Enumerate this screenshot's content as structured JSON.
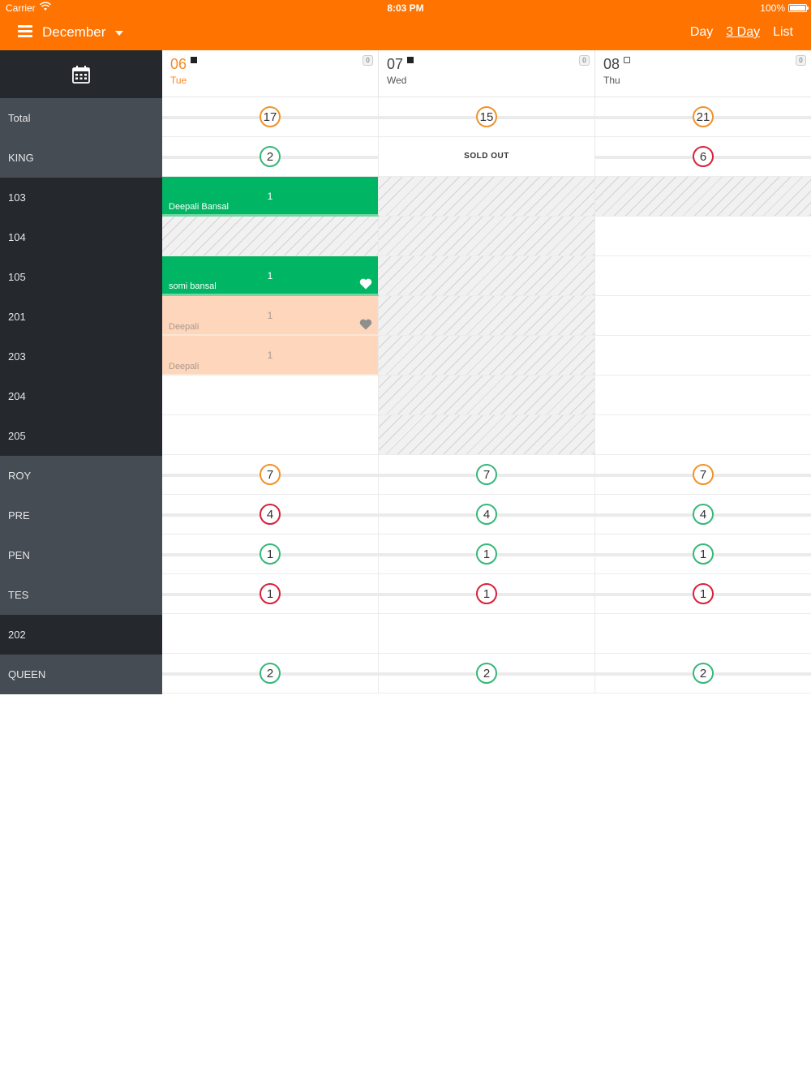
{
  "status_bar": {
    "carrier": "Carrier",
    "time": "8:03 PM",
    "battery": "100%"
  },
  "nav": {
    "month": "December",
    "tabs": [
      "Day",
      "3 Day",
      "List"
    ],
    "active_tab": "3 Day"
  },
  "colors": {
    "brand": "#ff7300",
    "today": "#f58a1f",
    "booked": "#00b564",
    "tentative": "#fed6bb",
    "sidebar_type": "#464c54",
    "sidebar_room": "#25292d"
  },
  "days": [
    {
      "num": "06",
      "name": "Tue",
      "count": "0",
      "today": true,
      "note": "filled"
    },
    {
      "num": "07",
      "name": "Wed",
      "count": "0",
      "today": false,
      "note": "filled"
    },
    {
      "num": "08",
      "name": "Thu",
      "count": "0",
      "today": false,
      "note": "empty"
    }
  ],
  "rows": [
    {
      "label": "Total",
      "kind": "type",
      "cells": [
        {
          "t": "avail",
          "v": "17",
          "c": "orange"
        },
        {
          "t": "avail",
          "v": "15",
          "c": "orange"
        },
        {
          "t": "avail",
          "v": "21",
          "c": "orange"
        }
      ]
    },
    {
      "label": "KING",
      "kind": "type",
      "cells": [
        {
          "t": "avail",
          "v": "2",
          "c": "green"
        },
        {
          "t": "soldout",
          "v": "SOLD OUT"
        },
        {
          "t": "avail",
          "v": "6",
          "c": "red"
        }
      ]
    },
    {
      "label": "103",
      "kind": "room",
      "cells": [
        {
          "t": "booking",
          "style": "green",
          "count": "1",
          "guest": "Deepali Bansal",
          "heart": false
        },
        {
          "t": "blocked"
        },
        {
          "t": "blocked"
        }
      ]
    },
    {
      "label": "104",
      "kind": "room",
      "cells": [
        {
          "t": "blocked"
        },
        {
          "t": "blocked"
        },
        {
          "t": "empty"
        }
      ]
    },
    {
      "label": "105",
      "kind": "room",
      "cells": [
        {
          "t": "booking",
          "style": "green",
          "count": "1",
          "guest": "somi bansal",
          "heart": true
        },
        {
          "t": "blocked"
        },
        {
          "t": "empty"
        }
      ]
    },
    {
      "label": "201",
      "kind": "room",
      "cells": [
        {
          "t": "booking",
          "style": "peach",
          "count": "1",
          "guest": "Deepali",
          "heart": true
        },
        {
          "t": "blocked"
        },
        {
          "t": "empty"
        }
      ]
    },
    {
      "label": "203",
      "kind": "room",
      "cells": [
        {
          "t": "booking",
          "style": "peach",
          "count": "1",
          "guest": "Deepali",
          "heart": false
        },
        {
          "t": "blocked"
        },
        {
          "t": "empty"
        }
      ]
    },
    {
      "label": "204",
      "kind": "room",
      "cells": [
        {
          "t": "empty"
        },
        {
          "t": "blocked"
        },
        {
          "t": "empty"
        }
      ]
    },
    {
      "label": "205",
      "kind": "room",
      "cells": [
        {
          "t": "empty"
        },
        {
          "t": "blocked"
        },
        {
          "t": "empty"
        }
      ]
    },
    {
      "label": "ROY",
      "kind": "type",
      "cells": [
        {
          "t": "avail",
          "v": "7",
          "c": "orange"
        },
        {
          "t": "avail",
          "v": "7",
          "c": "green"
        },
        {
          "t": "avail",
          "v": "7",
          "c": "orange"
        }
      ]
    },
    {
      "label": "PRE",
      "kind": "type",
      "cells": [
        {
          "t": "avail",
          "v": "4",
          "c": "red"
        },
        {
          "t": "avail",
          "v": "4",
          "c": "green"
        },
        {
          "t": "avail",
          "v": "4",
          "c": "green"
        }
      ]
    },
    {
      "label": "PEN",
      "kind": "type",
      "cells": [
        {
          "t": "avail",
          "v": "1",
          "c": "green"
        },
        {
          "t": "avail",
          "v": "1",
          "c": "green"
        },
        {
          "t": "avail",
          "v": "1",
          "c": "green"
        }
      ]
    },
    {
      "label": "TES",
      "kind": "type",
      "cells": [
        {
          "t": "avail",
          "v": "1",
          "c": "red"
        },
        {
          "t": "avail",
          "v": "1",
          "c": "red"
        },
        {
          "t": "avail",
          "v": "1",
          "c": "red"
        }
      ]
    },
    {
      "label": "202",
      "kind": "room",
      "cells": [
        {
          "t": "empty"
        },
        {
          "t": "empty"
        },
        {
          "t": "empty"
        }
      ]
    },
    {
      "label": "QUEEN",
      "kind": "type",
      "cells": [
        {
          "t": "avail",
          "v": "2",
          "c": "green"
        },
        {
          "t": "avail",
          "v": "2",
          "c": "green"
        },
        {
          "t": "avail",
          "v": "2",
          "c": "green"
        }
      ]
    }
  ]
}
